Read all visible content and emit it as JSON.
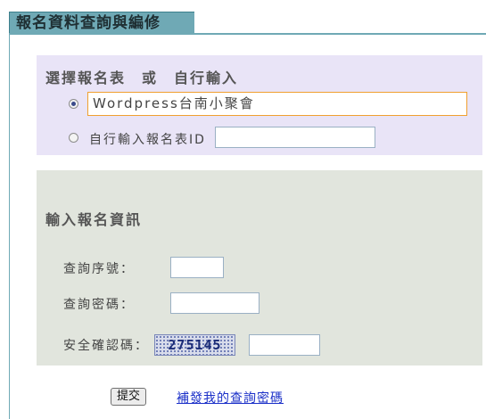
{
  "header": {
    "title": "報名資料查詢與編修"
  },
  "select_form": {
    "title": "選擇報名表　或　自行輸入",
    "selected_form": "Wordpress台南小聚會",
    "custom_label": "自行輸入報名表ID",
    "custom_value": ""
  },
  "info": {
    "title": "輸入報名資訊",
    "serial_label": "查詢序號：",
    "serial_value": "",
    "password_label": "查詢密碼：",
    "password_value": "",
    "captcha_label": "安全確認碼：",
    "captcha_text": "275145",
    "captcha_value": ""
  },
  "actions": {
    "submit_label": "提交",
    "resend_link": "補發我的查詢密碼"
  },
  "colors": {
    "tab": "#6fa9b5",
    "select_panel": "#e9e4f7",
    "info_panel": "#e1e5dd",
    "focus_border": "#f0a030",
    "link": "#1a2fc8"
  }
}
